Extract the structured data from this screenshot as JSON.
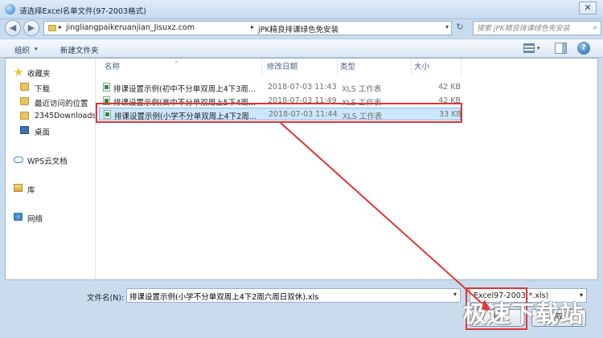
{
  "window": {
    "title": "请选择Excel名单文件(97-2003格式)",
    "close_glyph": "✕"
  },
  "address_bar": {
    "crumbs": [
      "jingliangpaikeruanjian_Jisuxz.com",
      "jPK精良排课绿色免安装"
    ],
    "search_placeholder": "搜索 jPK精良排课绿色免安装"
  },
  "toolbar": {
    "organize_label": "组织",
    "new_folder_label": "新建文件夹"
  },
  "nav_pane": {
    "items": [
      {
        "label": "收藏夹",
        "icon": "star-icon"
      },
      {
        "label": "下载",
        "icon": "folder-icon"
      },
      {
        "label": "最近访问的位置",
        "icon": "folder-icon"
      },
      {
        "label": "2345Downloads",
        "icon": "folder-icon"
      },
      {
        "label": "桌面",
        "icon": "desktop-icon"
      },
      {
        "label": "WPS云文档",
        "icon": "cloud-icon"
      },
      {
        "label": "库",
        "icon": "library-icon"
      },
      {
        "label": "网络",
        "icon": "network-icon"
      }
    ]
  },
  "file_list": {
    "columns": [
      "名称",
      "修改日期",
      "类型",
      "大小"
    ],
    "rows": [
      {
        "name": "排课设置示例(初中不分单双周上4下3周...",
        "date": "2018-07-03 11:43",
        "type": "XLS 工作表",
        "size": "42 KB"
      },
      {
        "name": "排课设置示例(高中不分单双周上5下4周...",
        "date": "2018-07-03 11:49",
        "type": "XLS 工作表",
        "size": "42 KB"
      },
      {
        "name": "排课设置示例(小学不分单双周上4下2周...",
        "date": "2018-07-03 11:44",
        "type": "XLS 工作表",
        "size": "33 KB",
        "selected": true
      }
    ]
  },
  "bottom": {
    "filename_label": "文件名(N):",
    "filename_value": "排课设置示例(小学不分单双周上4下2周六周日双休).xls",
    "filetype_value": "Excel97-2003(*.xls)",
    "open_label": "打",
    "cancel_label": "取"
  },
  "watermark": "极速下载站",
  "colors": {
    "highlight": "#e03535",
    "selected_row": "#cde6fb"
  }
}
